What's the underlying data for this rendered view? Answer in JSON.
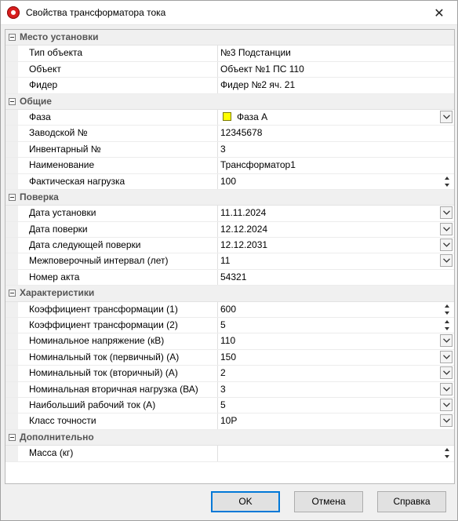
{
  "window": {
    "title": "Свойства трансформатора тока",
    "close_glyph": "✕"
  },
  "categories": [
    {
      "label": "Место установки",
      "properties": [
        {
          "name": "Тип объекта",
          "value": "№3 Подстанции",
          "editor": "text"
        },
        {
          "name": "Объект",
          "value": "Объект №1 ПС 110",
          "editor": "text"
        },
        {
          "name": "Фидер",
          "value": "Фидер №2 яч. 21",
          "editor": "text"
        }
      ]
    },
    {
      "label": "Общие",
      "properties": [
        {
          "name": "Фаза",
          "value": "Фаза А",
          "editor": "dropdown",
          "swatch_color": "#ffff00"
        },
        {
          "name": "Заводской №",
          "value": "12345678",
          "editor": "text"
        },
        {
          "name": "Инвентарный №",
          "value": "3",
          "editor": "text"
        },
        {
          "name": "Наименование",
          "value": "Трансформатор1",
          "editor": "text"
        },
        {
          "name": "Фактическая нагрузка",
          "value": "100",
          "editor": "spin"
        }
      ]
    },
    {
      "label": "Поверка",
      "properties": [
        {
          "name": "Дата установки",
          "value": "11.11.2024",
          "editor": "dropdown"
        },
        {
          "name": "Дата поверки",
          "value": "12.12.2024",
          "editor": "dropdown"
        },
        {
          "name": "Дата следующей поверки",
          "value": "12.12.2031",
          "editor": "dropdown"
        },
        {
          "name": "Межповерочный интервал (лет)",
          "value": "11",
          "editor": "dropdown"
        },
        {
          "name": "Номер акта",
          "value": "54321",
          "editor": "text"
        }
      ]
    },
    {
      "label": "Характеристики",
      "properties": [
        {
          "name": "Коэффициент трансформации (1)",
          "value": "600",
          "editor": "spin"
        },
        {
          "name": "Коэффициент трансформации (2)",
          "value": "5",
          "editor": "spin"
        },
        {
          "name": "Номинальное напряжение (кВ)",
          "value": "110",
          "editor": "dropdown"
        },
        {
          "name": "Номинальный ток (первичный) (А)",
          "value": "150",
          "editor": "dropdown"
        },
        {
          "name": "Номинальный ток (вторичный) (А)",
          "value": "2",
          "editor": "dropdown"
        },
        {
          "name": "Номинальная вторичная нагрузка (ВА)",
          "value": "3",
          "editor": "dropdown"
        },
        {
          "name": "Наибольший рабочий ток (А)",
          "value": "5",
          "editor": "dropdown"
        },
        {
          "name": "Класс точности",
          "value": "10Р",
          "editor": "dropdown"
        }
      ]
    },
    {
      "label": "Дополнительно",
      "properties": [
        {
          "name": "Масса (кг)",
          "value": "",
          "editor": "spin"
        }
      ]
    }
  ],
  "buttons": {
    "ok": "OK",
    "cancel": "Отмена",
    "help": "Справка"
  },
  "colors": {
    "default_button_border": "#0078d7",
    "phase_a": "#ffff00"
  }
}
